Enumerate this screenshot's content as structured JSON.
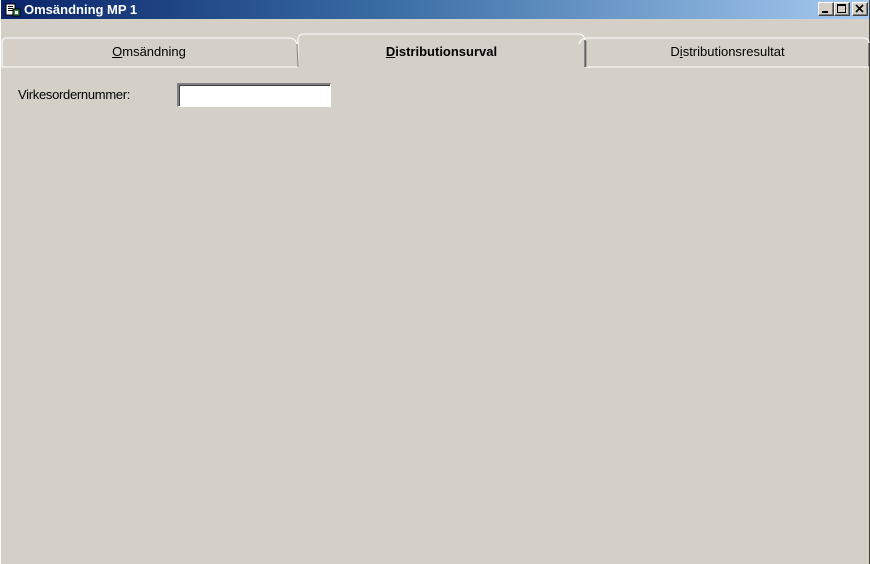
{
  "window": {
    "title": "Omsändning MP 1",
    "controls": {
      "minimize": "minimize-icon",
      "maximize": "maximize-icon",
      "close": "close-icon"
    }
  },
  "tabs": [
    {
      "label_pre": "",
      "mnemonic": "O",
      "label_post": "msändning",
      "active": false
    },
    {
      "label_pre": "",
      "mnemonic": "D",
      "label_post": "istributionsurval",
      "active": true
    },
    {
      "label_pre": "D",
      "mnemonic": "i",
      "label_post": "stributionsresultat",
      "active": false
    }
  ],
  "form": {
    "virkesordernummer_label": "Virkesordernummer:",
    "virkesordernummer_value": ""
  },
  "colors": {
    "title_gradient_start": "#0a246a",
    "title_gradient_end": "#a6caf0",
    "face": "#d4d0c8"
  }
}
